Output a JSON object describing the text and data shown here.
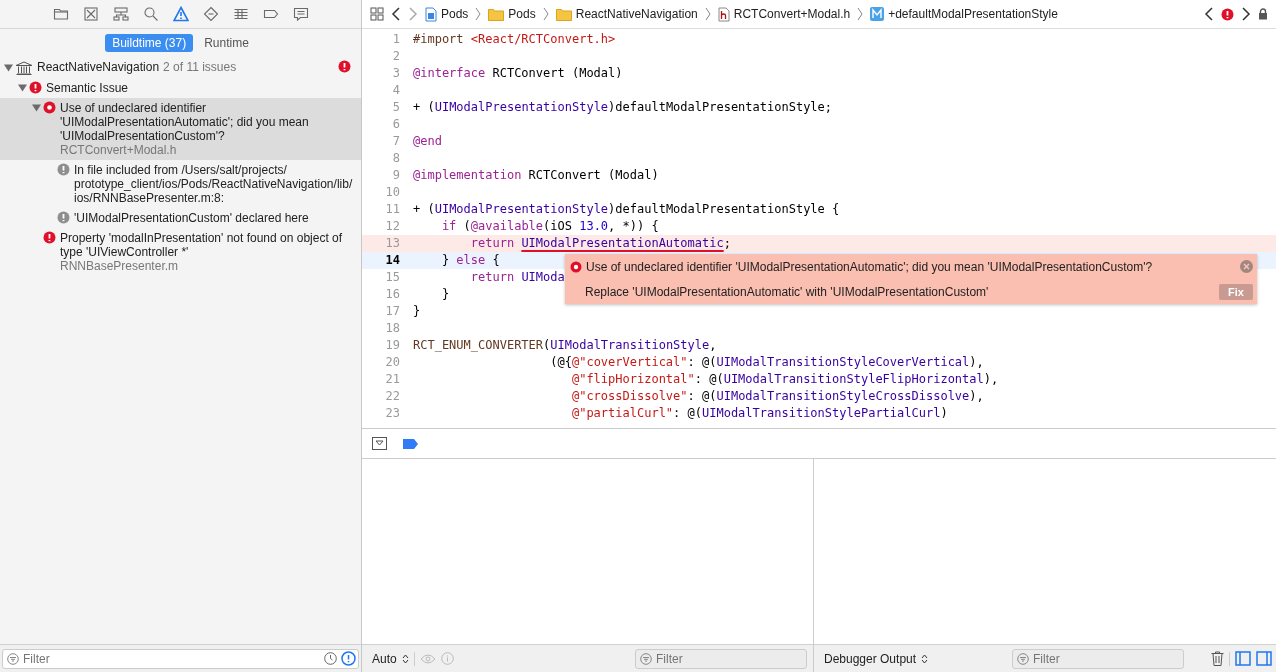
{
  "navigator_tabs": [
    {
      "kind": "folder",
      "selected": false
    },
    {
      "kind": "source",
      "selected": false
    },
    {
      "kind": "symbol",
      "selected": false
    },
    {
      "kind": "find",
      "selected": false
    },
    {
      "kind": "issue",
      "selected": true
    },
    {
      "kind": "test",
      "selected": false
    },
    {
      "kind": "debug",
      "selected": false
    },
    {
      "kind": "breakpoint",
      "selected": false
    },
    {
      "kind": "report",
      "selected": false
    }
  ],
  "segments": [
    {
      "label": "Buildtime (37)",
      "selected": true
    },
    {
      "label": "Runtime",
      "selected": false
    }
  ],
  "issues": [
    {
      "kind": "project",
      "title": "ReactNativeNavigation",
      "detail": "2 of 11 issues",
      "badge": true,
      "expanded": true,
      "selected": false,
      "children": [
        {
          "kind": "group",
          "title": "Semantic Issue",
          "expanded": true,
          "selected": false,
          "children": [
            {
              "kind": "error",
              "title": "Use of undeclared identifier 'UIModalPresentationAutomatic'; did you mean 'UIModalPresentationCustom'?",
              "file": "RCTConvert+Modal.h",
              "expanded": true,
              "selected": true,
              "children": [
                {
                  "kind": "note",
                  "title": "In file included from /Users/salt/projects/prototype_client/ios/Pods/ReactNativeNavigation/lib/ios/RNNBasePresenter.m:8:",
                  "selected": false
                },
                {
                  "kind": "note",
                  "title": "'UIModalPresentationCustom' declared here",
                  "selected": false
                }
              ]
            },
            {
              "kind": "error",
              "title": "Property 'modalInPresentation' not found on object of type 'UIViewController *'",
              "file": "RNNBasePresenter.m",
              "selected": false
            }
          ]
        }
      ]
    }
  ],
  "sidebar_filter": {
    "placeholder": "Filter"
  },
  "breadcrumb": [
    {
      "kind": "project",
      "label": "Pods"
    },
    {
      "kind": "folder",
      "label": "Pods"
    },
    {
      "kind": "folder",
      "label": "ReactNativeNavigation"
    },
    {
      "kind": "header",
      "label": "RCTConvert+Modal.h"
    },
    {
      "kind": "method",
      "label": "+defaultModalPresentationStyle"
    }
  ],
  "code": [
    {
      "number": "1",
      "kind": "normal",
      "tokens": [
        {
          "kind": "pre",
          "text": "#import "
        },
        {
          "kind": "string",
          "text": "<React/RCTConvert.h>"
        }
      ]
    },
    {
      "number": "2",
      "kind": "normal"
    },
    {
      "number": "3",
      "kind": "normal",
      "tokens": [
        {
          "kind": "keyword",
          "text": "@interface"
        },
        {
          "kind": "plain",
          "text": " RCTConvert (Modal)"
        }
      ]
    },
    {
      "number": "4",
      "kind": "normal"
    },
    {
      "number": "5",
      "kind": "normal",
      "tokens": [
        {
          "kind": "plain",
          "text": "+ ("
        },
        {
          "kind": "type",
          "text": "UIModalPresentationStyle"
        },
        {
          "kind": "plain",
          "text": ")defaultModalPresentationStyle;"
        }
      ]
    },
    {
      "number": "6",
      "kind": "normal"
    },
    {
      "number": "7",
      "kind": "normal",
      "tokens": [
        {
          "kind": "keyword",
          "text": "@end"
        }
      ]
    },
    {
      "number": "8",
      "kind": "normal"
    },
    {
      "number": "9",
      "kind": "normal",
      "tokens": [
        {
          "kind": "keyword",
          "text": "@implementation"
        },
        {
          "kind": "plain",
          "text": " RCTConvert (Modal)"
        }
      ]
    },
    {
      "number": "10",
      "kind": "normal"
    },
    {
      "number": "11",
      "kind": "normal",
      "tokens": [
        {
          "kind": "plain",
          "text": "+ ("
        },
        {
          "kind": "type",
          "text": "UIModalPresentationStyle"
        },
        {
          "kind": "plain",
          "text": ")defaultModalPresentationStyle {"
        }
      ]
    },
    {
      "number": "12",
      "kind": "normal",
      "tokens": [
        {
          "kind": "keyword",
          "text": "    if"
        },
        {
          "kind": "plain",
          "text": " ("
        },
        {
          "kind": "keyword",
          "text": "@available"
        },
        {
          "kind": "plain",
          "text": "(iOS "
        },
        {
          "kind": "number",
          "text": "13.0"
        },
        {
          "kind": "plain",
          "text": ", *)) {"
        }
      ]
    },
    {
      "number": "13",
      "kind": "error",
      "tokens": [
        {
          "kind": "keyword",
          "text": "        return "
        },
        {
          "kind": "error",
          "text": "UIModalPresentationAutomatic"
        },
        {
          "kind": "plain",
          "text": ";"
        }
      ]
    },
    {
      "number": "14",
      "kind": "current",
      "tokens": [
        {
          "kind": "plain",
          "text": "    } "
        },
        {
          "kind": "keyword",
          "text": "else"
        },
        {
          "kind": "plain",
          "text": " {"
        }
      ]
    },
    {
      "number": "15",
      "kind": "normal",
      "tokens": [
        {
          "kind": "keyword",
          "text": "        return "
        },
        {
          "kind": "type",
          "text": "UIModa"
        }
      ]
    },
    {
      "number": "16",
      "kind": "normal",
      "tokens": [
        {
          "kind": "plain",
          "text": "    }"
        }
      ]
    },
    {
      "number": "17",
      "kind": "normal",
      "tokens": [
        {
          "kind": "plain",
          "text": "}"
        }
      ]
    },
    {
      "number": "18",
      "kind": "normal"
    },
    {
      "number": "19",
      "kind": "normal",
      "tokens": [
        {
          "kind": "pre",
          "text": "RCT_ENUM_CONVERTER"
        },
        {
          "kind": "plain",
          "text": "("
        },
        {
          "kind": "type",
          "text": "UIModalTransitionStyle"
        },
        {
          "kind": "plain",
          "text": ","
        }
      ]
    },
    {
      "number": "20",
      "kind": "normal",
      "tokens": [
        {
          "kind": "plain",
          "text": "                   (@{"
        },
        {
          "kind": "string",
          "text": "@\"coverVertical\""
        },
        {
          "kind": "plain",
          "text": ": @("
        },
        {
          "kind": "type",
          "text": "UIModalTransitionStyleCoverVertical"
        },
        {
          "kind": "plain",
          "text": "),"
        }
      ]
    },
    {
      "number": "21",
      "kind": "normal",
      "tokens": [
        {
          "kind": "string",
          "text": "                      @\"flipHorizontal\""
        },
        {
          "kind": "plain",
          "text": ": @("
        },
        {
          "kind": "type",
          "text": "UIModalTransitionStyleFlipHorizontal"
        },
        {
          "kind": "plain",
          "text": "),"
        }
      ]
    },
    {
      "number": "22",
      "kind": "normal",
      "tokens": [
        {
          "kind": "string",
          "text": "                      @\"crossDissolve\""
        },
        {
          "kind": "plain",
          "text": ": @("
        },
        {
          "kind": "type",
          "text": "UIModalTransitionStyleCrossDissolve"
        },
        {
          "kind": "plain",
          "text": "),"
        }
      ]
    },
    {
      "number": "23",
      "kind": "normal",
      "tokens": [
        {
          "kind": "string",
          "text": "                      @\"partialCurl\""
        },
        {
          "kind": "plain",
          "text": ": @("
        },
        {
          "kind": "type",
          "text": "UIModalTransitionStylePartialCurl"
        },
        {
          "kind": "plain",
          "text": ")"
        }
      ]
    }
  ],
  "popup": {
    "message": "Use of undeclared identifier 'UIModalPresentationAutomatic'; did you mean 'UIModalPresentationCustom'?",
    "fix_text": "Replace 'UIModalPresentationAutomatic' with 'UIModalPresentationCustom'",
    "fix_button": "Fix"
  },
  "variables_bar": {
    "scope": "Auto",
    "filter_placeholder": "Filter"
  },
  "console_bar": {
    "output": "Debugger Output",
    "filter_placeholder": "Filter"
  }
}
